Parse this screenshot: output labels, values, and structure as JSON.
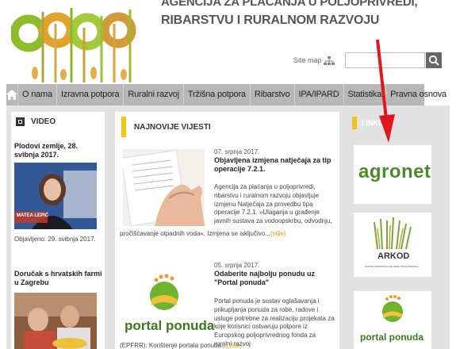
{
  "header": {
    "agency_line1": "AGENCIJA ZA PLAĆANJA U POLJOPRIVREDI,",
    "agency_line2": "RIBARSTVU I RURALNOM RAZVOJU",
    "sitemap_label": "Site map",
    "search_placeholder": ""
  },
  "nav": {
    "items": [
      "O nama",
      "Izravna potpora",
      "Ruralni razvoj",
      "Tržišna potpora",
      "Ribarstvo",
      "IPA/IPARD",
      "Statistika",
      "Pravna osnova"
    ]
  },
  "video": {
    "heading": "VIDEO",
    "item1_title": "Plodovi zemlje, 28. svibnja 2017.",
    "item1_caption": "MATEA LEPIĆ",
    "item1_date": "Objavljeno: 29. svibnja 2017.",
    "item2_title": "Doručak s hrvatskih farmi u Zagrebu"
  },
  "news": {
    "heading": "NAJNOVIJE VIJESTI",
    "item1": {
      "date": "07. srpnja 2017.",
      "title": "Objavljena izmjena natječaja za tip operacije 7.2.1.",
      "body_right": "Agencija za plaćanja u poljoprivredi, ribarstvu i ruralnom razvoju objavljuje izmjenu Natječaja za provedbu tipa operacije 7.2.1. »Ulaganja u građenje javnih sustava za vodoopskrbu, odvodnju,",
      "body_full": "pročišćavanje otpadnih voda«. Izmjena se isključivo...",
      "more": "(više)"
    },
    "item2": {
      "date": "05. srpnja 2017.",
      "title": "Odaberite najbolju ponudu uz \"Portal ponuda\"",
      "body_right": "Portal ponuda je sustav oglašavanja i prikupljanja ponuda za robe, radove i usluge potrebne za realizaciju projekata za koje korisnici ostvaruju potpore iz Europskog poljoprivrednog fonda za ruralni razvoj",
      "body_full": "(EPFRR). Korištenje portala ponuda...",
      "more": "(više)"
    },
    "portal_label": "portal ponuda"
  },
  "links": {
    "heading": "LINKOVI",
    "agronet_label": "agronet",
    "arkod_label": "ARKOD",
    "arkod_sub": "SUSTAV IDENTIFIKACIJE ZEMLJIŠNIH PARCELA",
    "portal_label": "portal ponuda"
  },
  "colors": {
    "accent_yellow": "#f1c40f",
    "nav_gray": "#b7b7b7",
    "agronet_green": "#4b8a2a",
    "arrow_red": "#e3161b",
    "more_orange": "#e69500"
  }
}
